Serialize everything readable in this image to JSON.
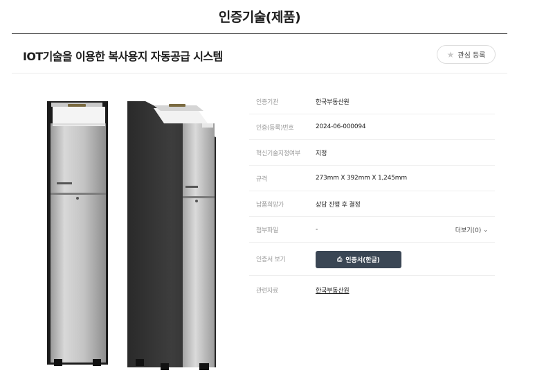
{
  "page": {
    "title": "인증기술(제품)"
  },
  "product": {
    "title": "IOT기술을 이용한 복사용지 자동공급 시스템",
    "favorite_label": "관심 등록",
    "favorite_icon": "star-icon"
  },
  "details": {
    "rows": [
      {
        "label": "인증기관",
        "value": "한국부동산원"
      },
      {
        "label": "인증(등록)번호",
        "value": "2024-06-000094"
      },
      {
        "label": "혁신기술지정여부",
        "value": "지정"
      },
      {
        "label": "규격",
        "value": "273mm X 392mm X 1,245mm"
      },
      {
        "label": "납품희망가",
        "value": "상담 진행 후 결정"
      },
      {
        "label": "첨부파일",
        "value": "-"
      }
    ],
    "more_label": "더보기(0)",
    "cert_label": "인증서 보기",
    "cert_button": "인증서(한글)",
    "related_label": "관련자료",
    "related_value": "한국부동산원"
  },
  "colors": {
    "accent_button": "#3a4654",
    "title_rule": "#555555"
  }
}
